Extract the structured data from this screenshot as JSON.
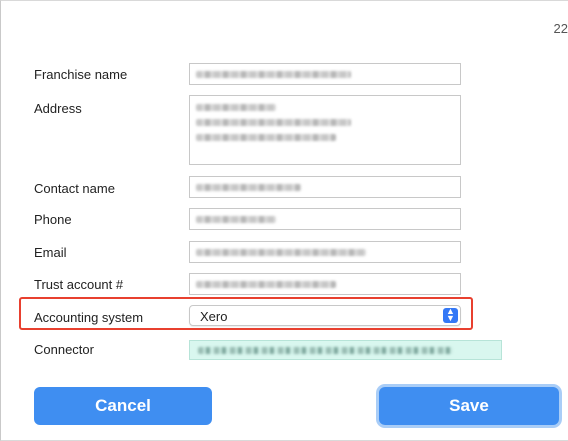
{
  "page": {
    "number": "22"
  },
  "form": {
    "franchise_name": {
      "label": "Franchise name"
    },
    "address": {
      "label": "Address"
    },
    "contact_name": {
      "label": "Contact name"
    },
    "phone": {
      "label": "Phone"
    },
    "email": {
      "label": "Email"
    },
    "trust_account": {
      "label": "Trust account #"
    },
    "accounting_system": {
      "label": "Accounting system",
      "value": "Xero"
    },
    "connector": {
      "label": "Connector"
    }
  },
  "buttons": {
    "cancel_label": "Cancel",
    "save_label": "Save"
  },
  "colors": {
    "accent": "#3f8ef1",
    "highlight": "#e8402f",
    "connector_bg": "#d9f7ef"
  },
  "icons": {
    "select_arrow": "chevron-up-down-icon"
  }
}
